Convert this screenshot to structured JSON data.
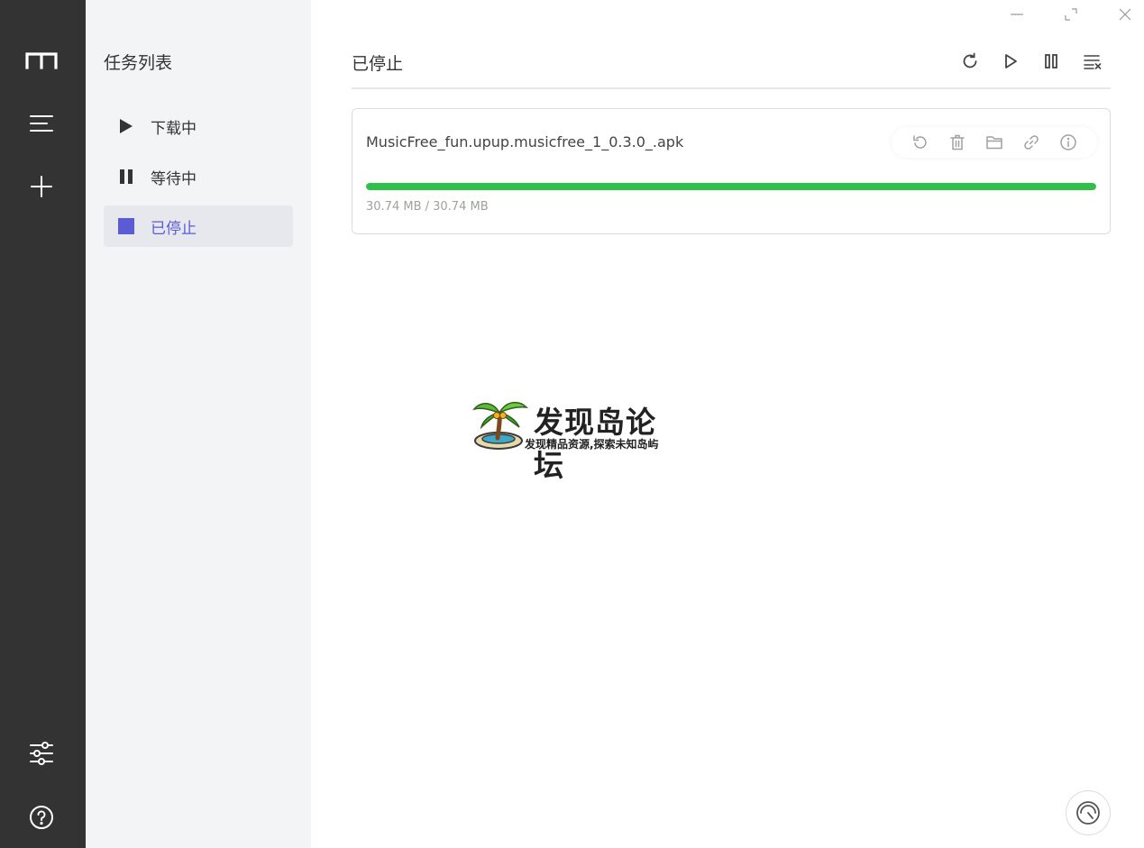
{
  "sidebar": {
    "title": "任务列表",
    "items": [
      {
        "label": "下载中",
        "icon": "play-icon"
      },
      {
        "label": "等待中",
        "icon": "pause-icon"
      },
      {
        "label": "已停止",
        "icon": "stop-icon",
        "active": true
      }
    ]
  },
  "main": {
    "title": "已停止",
    "toolbar": [
      "refresh-icon",
      "play-icon",
      "pause-icon",
      "clear-list-icon"
    ]
  },
  "task": {
    "filename": "MusicFree_fun.upup.musicfree_1_0.3.0_.apk",
    "progress_percent": 100,
    "size_text": "30.74 MB / 30.74 MB",
    "actions": [
      "retry-icon",
      "delete-icon",
      "folder-icon",
      "link-icon",
      "info-icon"
    ]
  },
  "watermark": {
    "title": "发现岛论坛",
    "subtitle": "发现精品资源,探索未知岛屿"
  },
  "colors": {
    "rail": "#333333",
    "panel": "#f3f4f6",
    "accent": "#5b5bd6",
    "progress": "#2fbf4a"
  }
}
